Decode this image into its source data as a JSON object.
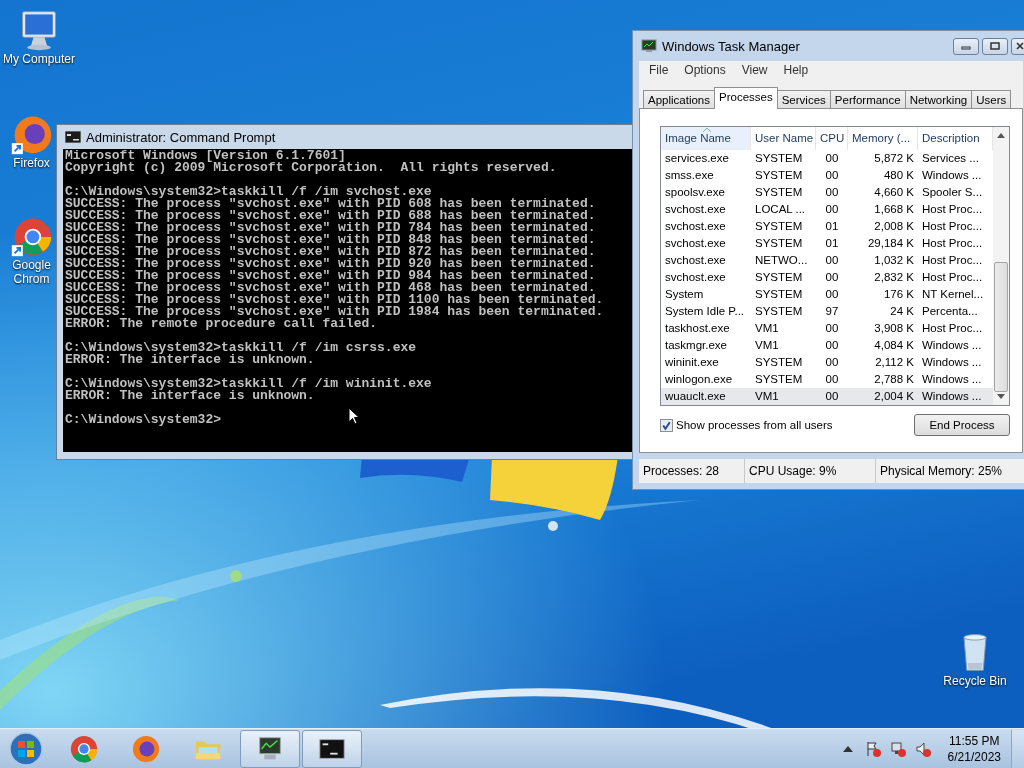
{
  "desktop_icons": [
    {
      "kind": "computer",
      "label": "My Computer"
    },
    {
      "kind": "firefox",
      "label": "Firefox"
    },
    {
      "kind": "chrome",
      "label": "Google Chrom"
    },
    {
      "kind": "recycle",
      "label": "Recycle Bin"
    }
  ],
  "command_prompt": {
    "title": "Administrator:  Command Prompt",
    "blocks": [
      [
        "Microsoft Windows [Version 6.1.7601]",
        "Copyright (c) 2009 Microsoft Corporation.  All rights reserved."
      ],
      [
        "C:\\Windows\\system32>taskkill /f /im svchost.exe",
        "SUCCESS: The process \"svchost.exe\" with PID 608 has been terminated.",
        "SUCCESS: The process \"svchost.exe\" with PID 688 has been terminated.",
        "SUCCESS: The process \"svchost.exe\" with PID 784 has been terminated.",
        "SUCCESS: The process \"svchost.exe\" with PID 848 has been terminated.",
        "SUCCESS: The process \"svchost.exe\" with PID 872 has been terminated.",
        "SUCCESS: The process \"svchost.exe\" with PID 920 has been terminated.",
        "SUCCESS: The process \"svchost.exe\" with PID 984 has been terminated.",
        "SUCCESS: The process \"svchost.exe\" with PID 468 has been terminated.",
        "SUCCESS: The process \"svchost.exe\" with PID 1100 has been terminated.",
        "SUCCESS: The process \"svchost.exe\" with PID 1984 has been terminated.",
        "ERROR: The remote procedure call failed."
      ],
      [
        "C:\\Windows\\system32>taskkill /f /im csrss.exe",
        "ERROR: The interface is unknown."
      ],
      [
        "C:\\Windows\\system32>taskkill /f /im wininit.exe",
        "ERROR: The interface is unknown."
      ],
      [
        "C:\\Windows\\system32>"
      ]
    ]
  },
  "task_manager": {
    "title": "Windows Task Manager",
    "menu": [
      "File",
      "Options",
      "View",
      "Help"
    ],
    "tabs": [
      {
        "label": "Applications",
        "selected": false
      },
      {
        "label": "Processes",
        "selected": true
      },
      {
        "label": "Services",
        "selected": false
      },
      {
        "label": "Performance",
        "selected": false
      },
      {
        "label": "Networking",
        "selected": false
      },
      {
        "label": "Users",
        "selected": false
      }
    ],
    "columns": [
      "Image Name",
      "User Name",
      "CPU",
      "Memory (...",
      "Description"
    ],
    "rows": [
      {
        "cells": [
          "services.exe",
          "SYSTEM",
          "00",
          "5,872 K",
          "Services ..."
        ],
        "selected": false
      },
      {
        "cells": [
          "smss.exe",
          "SYSTEM",
          "00",
          "480 K",
          "Windows ..."
        ],
        "selected": false
      },
      {
        "cells": [
          "spoolsv.exe",
          "SYSTEM",
          "00",
          "4,660 K",
          "Spooler S..."
        ],
        "selected": false
      },
      {
        "cells": [
          "svchost.exe",
          "LOCAL ...",
          "00",
          "1,668 K",
          "Host Proc..."
        ],
        "selected": false
      },
      {
        "cells": [
          "svchost.exe",
          "SYSTEM",
          "01",
          "2,008 K",
          "Host Proc..."
        ],
        "selected": false
      },
      {
        "cells": [
          "svchost.exe",
          "SYSTEM",
          "01",
          "29,184 K",
          "Host Proc..."
        ],
        "selected": false
      },
      {
        "cells": [
          "svchost.exe",
          "NETWO...",
          "00",
          "1,032 K",
          "Host Proc..."
        ],
        "selected": false
      },
      {
        "cells": [
          "svchost.exe",
          "SYSTEM",
          "00",
          "2,832 K",
          "Host Proc..."
        ],
        "selected": false
      },
      {
        "cells": [
          "System",
          "SYSTEM",
          "00",
          "176 K",
          "NT Kernel..."
        ],
        "selected": false
      },
      {
        "cells": [
          "System Idle P...",
          "SYSTEM",
          "97",
          "24 K",
          "Percenta..."
        ],
        "selected": false
      },
      {
        "cells": [
          "taskhost.exe",
          "VM1",
          "00",
          "3,908 K",
          "Host Proc..."
        ],
        "selected": false
      },
      {
        "cells": [
          "taskmgr.exe",
          "VM1",
          "00",
          "4,084 K",
          "Windows ..."
        ],
        "selected": false
      },
      {
        "cells": [
          "wininit.exe",
          "SYSTEM",
          "00",
          "2,112 K",
          "Windows ..."
        ],
        "selected": false
      },
      {
        "cells": [
          "winlogon.exe",
          "SYSTEM",
          "00",
          "2,788 K",
          "Windows ..."
        ],
        "selected": false
      },
      {
        "cells": [
          "wuauclt.exe",
          "VM1",
          "00",
          "2,004 K",
          "Windows ..."
        ],
        "selected": true
      }
    ],
    "show_all_users": {
      "label": "Show processes from all users",
      "checked": true
    },
    "end_button": "End Process",
    "status": [
      "Processes: 28",
      "CPU Usage: 9%",
      "Physical Memory: 25%"
    ]
  },
  "taskbar": {
    "apps": [
      {
        "kind": "chrome",
        "open": false
      },
      {
        "kind": "firefox",
        "open": false
      },
      {
        "kind": "explorer",
        "open": false
      },
      {
        "kind": "taskmgr",
        "open": true
      },
      {
        "kind": "cmd",
        "open": true
      }
    ],
    "time": "11:55 PM",
    "date": "6/21/2023"
  }
}
